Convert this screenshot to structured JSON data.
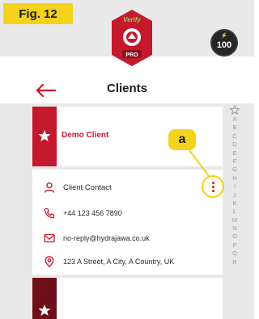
{
  "figure": {
    "label": "Fig. 12"
  },
  "app": {
    "logo_text": "Verify",
    "logo_sub": "PRO",
    "score": "100"
  },
  "topbar": {
    "title": "Clients"
  },
  "clients": [
    {
      "name": "Demo Client",
      "favorite": true
    }
  ],
  "contact": {
    "name": "Client Contact",
    "phone": "+44 123 456 7890",
    "email": "no-reply@hydrajawa.co.uk",
    "address": "123 A Street, A City, A Country, UK"
  },
  "callout": {
    "label": "a"
  },
  "alphabet": [
    "A",
    "B",
    "C",
    "D",
    "E",
    "F",
    "G",
    "H",
    "I",
    "J",
    "K",
    "L",
    "M",
    "N",
    "O",
    "P",
    "Q",
    "R"
  ],
  "colors": {
    "accent": "#c5192d",
    "highlight": "#f5d21c",
    "dark_strip": "#6e0f19"
  }
}
